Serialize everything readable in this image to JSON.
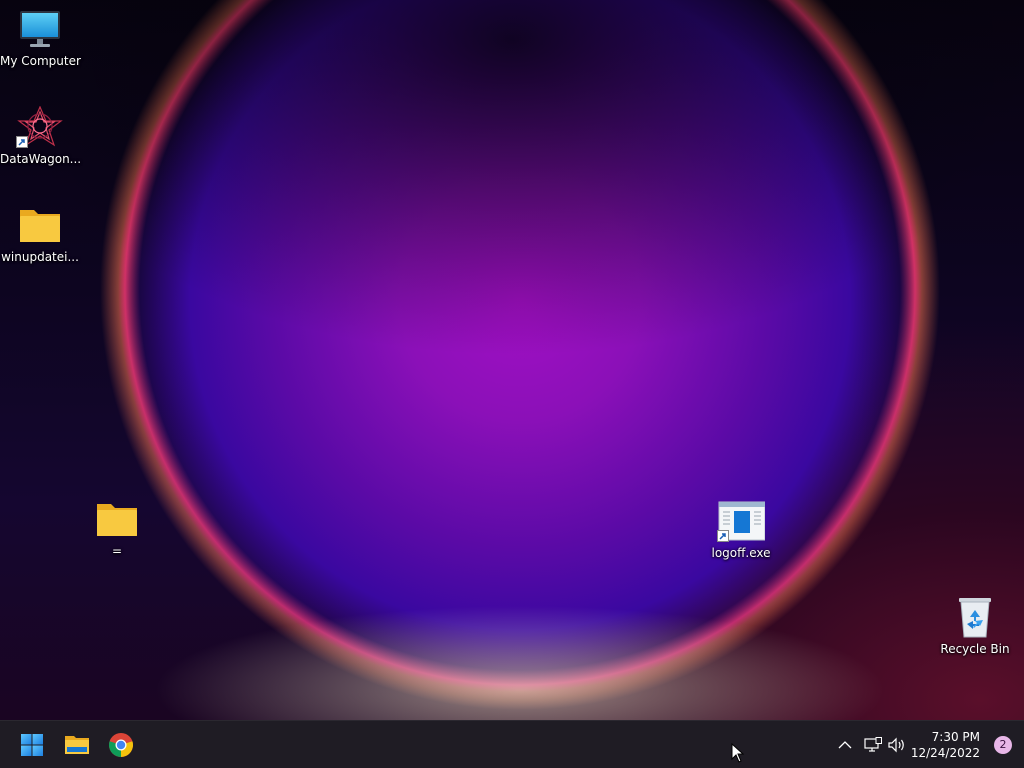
{
  "desktop": {
    "icons": [
      {
        "label": "My Computer",
        "icon": "monitor-icon"
      },
      {
        "label": "DataWagon...",
        "icon": "datawagon-app-icon",
        "shortcut": true
      },
      {
        "label": "winupdatei...",
        "icon": "folder-icon"
      },
      {
        "label": "=",
        "icon": "folder-icon"
      },
      {
        "label": "logoff.exe",
        "icon": "exe-app-icon",
        "shortcut": true
      },
      {
        "label": "Recycle Bin",
        "icon": "recycle-bin-icon"
      }
    ]
  },
  "taskbar": {
    "pinned": [
      {
        "name": "Start",
        "icon": "windows-start-icon"
      },
      {
        "name": "File Explorer",
        "icon": "file-explorer-icon"
      },
      {
        "name": "Google Chrome",
        "icon": "chrome-icon"
      }
    ],
    "tray": {
      "overflow_icon": "chevron-up-icon",
      "network_icon": "network-icon",
      "volume_icon": "volume-icon",
      "time": "7:30 PM",
      "date": "12/24/2022",
      "notification_count": "2"
    }
  },
  "colors": {
    "taskbar_bg": "#1f1c24",
    "folder_yellow": "#f8c940",
    "accent_blue": "#0a78d7"
  }
}
